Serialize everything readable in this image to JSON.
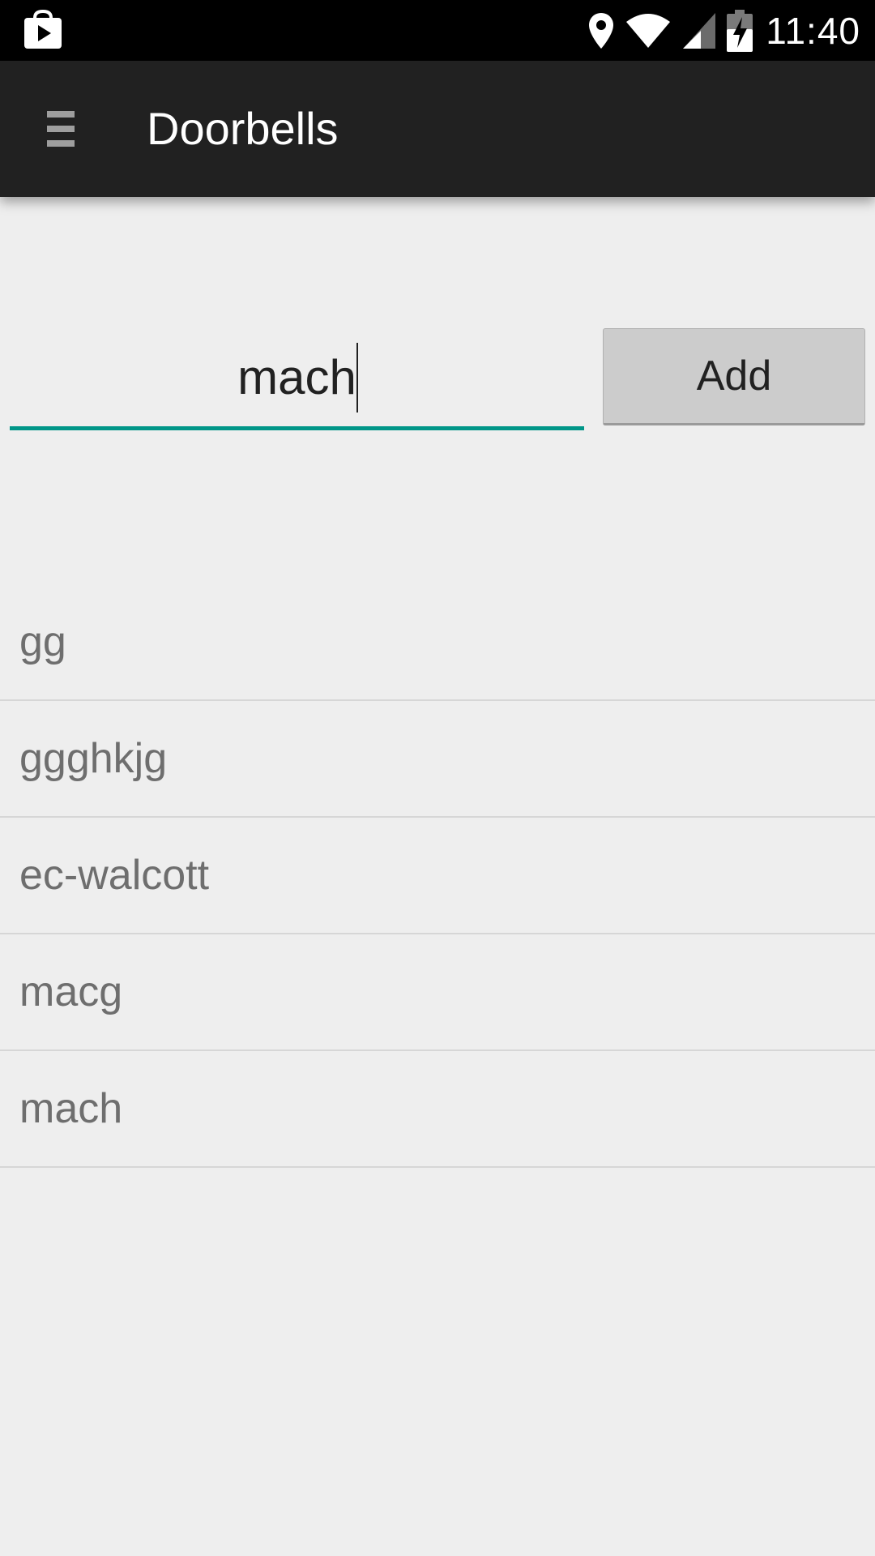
{
  "status_bar": {
    "time": "11:40",
    "icons": [
      "play-store-bag-icon",
      "location-pin-icon",
      "wifi-icon",
      "cell-signal-icon",
      "battery-charging-icon"
    ]
  },
  "action_bar": {
    "menu_icon": "hamburger-menu-icon",
    "title": "Doorbells"
  },
  "form": {
    "input_value": "mach",
    "add_label": "Add",
    "accent_color": "#009688"
  },
  "list": {
    "items": [
      {
        "label": "gg"
      },
      {
        "label": "ggghkjg"
      },
      {
        "label": "ec-walcott"
      },
      {
        "label": "macg"
      },
      {
        "label": "mach"
      }
    ]
  }
}
